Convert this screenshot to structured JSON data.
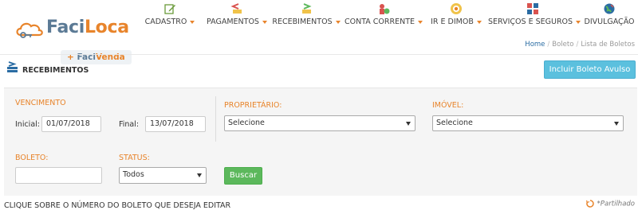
{
  "brand": {
    "name_prefix": "Faci",
    "name_suffix": "Loca",
    "sub_plus": "+",
    "sub_prefix": "Faci",
    "sub_suffix": "Venda"
  },
  "nav": {
    "items": [
      {
        "label": "CADASTRO",
        "icon": "edit-icon"
      },
      {
        "label": "PAGAMENTOS",
        "icon": "payments-icon"
      },
      {
        "label": "RECEBIMENTOS",
        "icon": "receipts-icon"
      },
      {
        "label": "CONTA CORRENTE",
        "icon": "account-icon"
      },
      {
        "label": "IR E DIMOB",
        "icon": "lion-icon"
      },
      {
        "label": "SERVIÇOS E SEGUROS",
        "icon": "puzzle-icon"
      },
      {
        "label": "DIVULGAÇÃO",
        "icon": "globe-icon"
      }
    ]
  },
  "breadcrumb": {
    "home": "Home",
    "level2": "Boleto",
    "current": "Lista de Boletos"
  },
  "section": {
    "title": "RECEBIMENTOS",
    "add_button": "Incluir Boleto Avulso"
  },
  "filters": {
    "vencimento_label": "VENCIMENTO",
    "inicial_label": "Inicial:",
    "inicial_value": "01/07/2018",
    "final_label": "Final:",
    "final_value": "13/07/2018",
    "proprietario_label": "PROPRIETÁRIO:",
    "proprietario_value": "Selecione",
    "imovel_label": "IMÓVEL:",
    "imovel_value": "Selecione",
    "boleto_label": "BOLETO:",
    "boleto_value": "",
    "status_label": "STATUS:",
    "status_value": "Todos",
    "search_button": "Buscar"
  },
  "footer": {
    "instruction": "CLIQUE SOBRE O NÚMERO DO BOLETO QUE DESEJA EDITAR",
    "shared_note": "*Partilhado"
  },
  "colors": {
    "accent": "#e8842b",
    "brand_blue": "#5b7a95",
    "info_button": "#5bc0de",
    "success_button": "#5cb85c",
    "link": "#2a6ca3"
  }
}
